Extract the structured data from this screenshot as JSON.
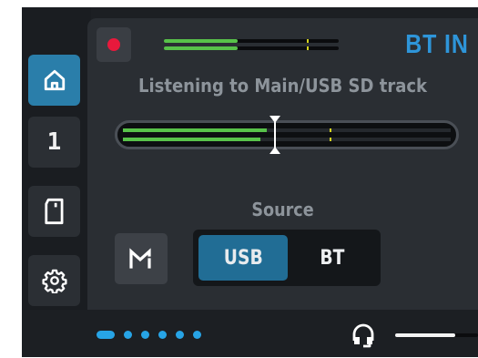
{
  "header": {
    "source_title": "BT IN",
    "record_button": "record",
    "mini_meter": {
      "level": 0.42,
      "peak": 0.82
    }
  },
  "status": {
    "text": "Listening to Main/USB SD track"
  },
  "meter": {
    "top_level": 0.44,
    "bottom_level": 0.42,
    "peak": 0.63,
    "cursor_position": 0.465
  },
  "source": {
    "label": "Source",
    "options": [
      "USB",
      "BT"
    ],
    "selected": "USB"
  },
  "sidebar": {
    "items": [
      {
        "icon": "home-icon",
        "active": true
      },
      {
        "label": "1"
      },
      {
        "icon": "sd-card-icon"
      },
      {
        "icon": "gear-icon"
      }
    ]
  },
  "mode_button": {
    "icon": "m-logo-icon"
  },
  "footer": {
    "page_count": 6,
    "current_page": 1,
    "headphone_icon": "headphone-icon",
    "volume_level": 0.72
  },
  "colors": {
    "accent": "#2e95d9",
    "active_tab": "#2a7eaa",
    "meter_green": "#58c24a",
    "peak_yellow": "#d4d31f",
    "record_red": "#e8193c"
  }
}
